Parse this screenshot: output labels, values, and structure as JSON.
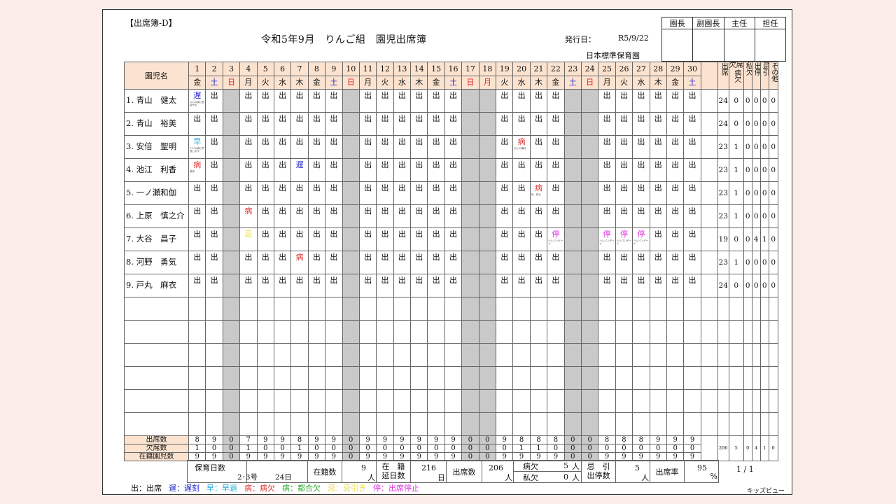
{
  "doc_id": "【出席簿-D】",
  "title": "令和5年9月　りんご組　園児出席簿",
  "issue_label": "発行日：",
  "issue_date": "R5/9/22",
  "school": "日本標準保育園",
  "approvals": [
    "園長",
    "副園長",
    "主任",
    "担任"
  ],
  "header": {
    "name_col": "園児名",
    "summary_cols": [
      {
        "top": "",
        "bottom": "出席"
      },
      {
        "top": "欠席",
        "bottom": "病欠"
      },
      {
        "top": "",
        "bottom": "私欠"
      },
      {
        "top": "",
        "bottom": "出停"
      },
      {
        "top": "",
        "bottom": "忌引"
      },
      {
        "top": "",
        "bottom": "その他"
      }
    ]
  },
  "days": [
    {
      "d": "1",
      "w": "金",
      "t": "w"
    },
    {
      "d": "2",
      "w": "土",
      "t": "sat"
    },
    {
      "d": "3",
      "w": "日",
      "t": "sun"
    },
    {
      "d": "4",
      "w": "月",
      "t": "w"
    },
    {
      "d": "5",
      "w": "火",
      "t": "w"
    },
    {
      "d": "6",
      "w": "水",
      "t": "w"
    },
    {
      "d": "7",
      "w": "木",
      "t": "w"
    },
    {
      "d": "8",
      "w": "金",
      "t": "w"
    },
    {
      "d": "9",
      "w": "土",
      "t": "sat"
    },
    {
      "d": "10",
      "w": "日",
      "t": "sun"
    },
    {
      "d": "11",
      "w": "月",
      "t": "w"
    },
    {
      "d": "12",
      "w": "火",
      "t": "w"
    },
    {
      "d": "13",
      "w": "水",
      "t": "w"
    },
    {
      "d": "14",
      "w": "木",
      "t": "w"
    },
    {
      "d": "15",
      "w": "金",
      "t": "w"
    },
    {
      "d": "16",
      "w": "土",
      "t": "sat"
    },
    {
      "d": "17",
      "w": "日",
      "t": "sun"
    },
    {
      "d": "18",
      "w": "月",
      "t": "sun"
    },
    {
      "d": "19",
      "w": "火",
      "t": "w"
    },
    {
      "d": "20",
      "w": "水",
      "t": "w"
    },
    {
      "d": "21",
      "w": "木",
      "t": "w"
    },
    {
      "d": "22",
      "w": "金",
      "t": "w"
    },
    {
      "d": "23",
      "w": "土",
      "t": "sat"
    },
    {
      "d": "24",
      "w": "日",
      "t": "sun"
    },
    {
      "d": "25",
      "w": "月",
      "t": "w"
    },
    {
      "d": "26",
      "w": "火",
      "t": "w"
    },
    {
      "d": "27",
      "w": "水",
      "t": "w"
    },
    {
      "d": "28",
      "w": "木",
      "t": "w"
    },
    {
      "d": "29",
      "w": "金",
      "t": "w"
    },
    {
      "d": "30",
      "w": "土",
      "t": "sat"
    }
  ],
  "gray_days": [
    3,
    10,
    17,
    18,
    23,
    24
  ],
  "mark_colors": {
    "出": "#111111",
    "遅": "#2222cc",
    "早": "#22aadd",
    "病": "#dd3333",
    "都": "#33aa33",
    "忌": "#e8d840",
    "停": "#dd33dd"
  },
  "children": [
    {
      "name": "1. 青山　健太",
      "marks": [
        "遅",
        "出",
        "",
        "出",
        "出",
        "出",
        "出",
        "出",
        "出",
        "",
        "出",
        "出",
        "出",
        "出",
        "出",
        "出",
        "",
        "",
        "出",
        "出",
        "出",
        "出",
        "",
        "",
        "出",
        "出",
        "出",
        "出",
        "出",
        "出"
      ],
      "notes": {
        "1": "10:30頃に登園予定"
      },
      "summary": [
        "24",
        "0",
        "0",
        "0",
        "0",
        "0"
      ]
    },
    {
      "name": "2. 青山　裕美",
      "marks": [
        "出",
        "出",
        "",
        "出",
        "出",
        "出",
        "出",
        "出",
        "出",
        "",
        "出",
        "出",
        "出",
        "出",
        "出",
        "出",
        "",
        "",
        "出",
        "出",
        "出",
        "出",
        "",
        "",
        "出",
        "出",
        "出",
        "出",
        "出",
        "出"
      ],
      "notes": {},
      "summary": [
        "24",
        "0",
        "0",
        "0",
        "0",
        "0"
      ]
    },
    {
      "name": "3. 安倍　聖明",
      "marks": [
        "早",
        "出",
        "",
        "出",
        "出",
        "出",
        "出",
        "出",
        "出",
        "",
        "出",
        "出",
        "出",
        "出",
        "出",
        "出",
        "",
        "",
        "出",
        "病",
        "出",
        "出",
        "",
        "",
        "出",
        "出",
        "出",
        "出",
        "出",
        "出"
      ],
      "notes": {
        "1": "11:30頃に早退します",
        "20": "のどの痛み"
      },
      "summary": [
        "23",
        "1",
        "0",
        "0",
        "0",
        "0"
      ]
    },
    {
      "name": "4. 池江　利香",
      "marks": [
        "病",
        "出",
        "",
        "出",
        "出",
        "出",
        "遅",
        "出",
        "出",
        "",
        "出",
        "出",
        "出",
        "出",
        "出",
        "出",
        "",
        "",
        "出",
        "出",
        "出",
        "出",
        "",
        "",
        "出",
        "出",
        "出",
        "出",
        "出",
        "出"
      ],
      "notes": {
        "1": "風邪"
      },
      "summary": [
        "23",
        "1",
        "0",
        "0",
        "0",
        "0"
      ]
    },
    {
      "name": "5. 一ノ瀬和伽",
      "marks": [
        "出",
        "出",
        "",
        "出",
        "出",
        "出",
        "出",
        "出",
        "出",
        "",
        "出",
        "出",
        "出",
        "出",
        "出",
        "出",
        "",
        "",
        "出",
        "出",
        "病",
        "出",
        "",
        "",
        "出",
        "出",
        "出",
        "出",
        "出",
        "出"
      ],
      "notes": {
        "21": "咳、鼻水"
      },
      "summary": [
        "23",
        "1",
        "0",
        "0",
        "0",
        "0"
      ]
    },
    {
      "name": "6. 上原　慎之介",
      "marks": [
        "出",
        "出",
        "",
        "病",
        "出",
        "出",
        "出",
        "出",
        "出",
        "",
        "出",
        "出",
        "出",
        "出",
        "出",
        "出",
        "",
        "",
        "出",
        "出",
        "出",
        "出",
        "",
        "",
        "出",
        "出",
        "出",
        "出",
        "出",
        "出"
      ],
      "notes": {},
      "summary": [
        "23",
        "1",
        "0",
        "0",
        "0",
        "0"
      ]
    },
    {
      "name": "7. 大谷　昌子",
      "marks": [
        "出",
        "出",
        "",
        "忌",
        "出",
        "出",
        "出",
        "出",
        "出",
        "",
        "出",
        "出",
        "出",
        "出",
        "出",
        "出",
        "",
        "",
        "出",
        "出",
        "出",
        "停",
        "",
        "",
        "停",
        "停",
        "停",
        "出",
        "出",
        "出"
      ],
      "notes": {
        "22": "ヘルパンギーナ",
        "25": "ヘルパンギーナ",
        "26": "ヘルパンギーナ",
        "27": "ヘルパンギーナ"
      },
      "summary": [
        "19",
        "0",
        "0",
        "4",
        "1",
        "0"
      ]
    },
    {
      "name": "8. 河野　勇気",
      "marks": [
        "出",
        "出",
        "",
        "出",
        "出",
        "出",
        "病",
        "出",
        "出",
        "",
        "出",
        "出",
        "出",
        "出",
        "出",
        "出",
        "",
        "",
        "出",
        "出",
        "出",
        "出",
        "",
        "",
        "出",
        "出",
        "出",
        "出",
        "出",
        "出"
      ],
      "notes": {},
      "summary": [
        "23",
        "1",
        "0",
        "0",
        "0",
        "0"
      ]
    },
    {
      "name": "9. 戸丸　麻衣",
      "marks": [
        "出",
        "出",
        "",
        "出",
        "出",
        "出",
        "出",
        "出",
        "出",
        "",
        "出",
        "出",
        "出",
        "出",
        "出",
        "出",
        "",
        "",
        "出",
        "出",
        "出",
        "出",
        "",
        "",
        "出",
        "出",
        "出",
        "出",
        "出",
        "出"
      ],
      "notes": {},
      "summary": [
        "24",
        "0",
        "0",
        "0",
        "0",
        "0"
      ]
    }
  ],
  "empty_rows": 6,
  "totals": {
    "labels": [
      "出席数",
      "欠席数",
      "在籍園児数"
    ],
    "attend": [
      "8",
      "9",
      "0",
      "7",
      "9",
      "9",
      "8",
      "9",
      "9",
      "0",
      "9",
      "9",
      "9",
      "9",
      "9",
      "9",
      "0",
      "0",
      "9",
      "8",
      "8",
      "8",
      "0",
      "0",
      "8",
      "8",
      "8",
      "9",
      "9",
      "9"
    ],
    "absent": [
      "1",
      "0",
      "0",
      "1",
      "0",
      "0",
      "1",
      "0",
      "0",
      "0",
      "0",
      "0",
      "0",
      "0",
      "0",
      "0",
      "0",
      "0",
      "0",
      "1",
      "1",
      "0",
      "0",
      "0",
      "0",
      "0",
      "0",
      "0",
      "0",
      "0"
    ],
    "enrolled": [
      "9",
      "9",
      "0",
      "9",
      "9",
      "9",
      "9",
      "9",
      "9",
      "0",
      "9",
      "9",
      "9",
      "9",
      "9",
      "9",
      "0",
      "0",
      "9",
      "9",
      "9",
      "9",
      "0",
      "0",
      "9",
      "9",
      "9",
      "9",
      "9",
      "9"
    ],
    "summary": [
      "206",
      "5",
      "0",
      "4",
      "1",
      "0"
    ]
  },
  "footer": {
    "hoiku_label": "保育日数",
    "hoiku_sub": "2･3号",
    "hoiku_val": "24日",
    "zaiseki_label": "在籍数",
    "zaiseki_val": "9",
    "zaiseki_unit": "人",
    "nobe_label1": "在　籍",
    "nobe_label2": "延日数",
    "nobe_val": "216",
    "nobe_unit": "日",
    "shusseki_label": "出席数",
    "shusseki_val": "206",
    "shusseki_unit": "人",
    "byoketsu_label": "病欠",
    "byoketsu_val": "5",
    "shiketsu_label": "私欠",
    "shiketsu_val": "0",
    "person_unit": "人",
    "kibiki_label1": "忌　引",
    "kibiki_label2": "出停数",
    "kibiki_val": "5",
    "rate_label": "出席率",
    "rate_val": "95",
    "rate_unit": "%"
  },
  "page_no": "1 / 1",
  "brand": "キッズビュー",
  "legend": [
    {
      "text": "出：出席",
      "color": "#111111"
    },
    {
      "text": "遅：遅刻",
      "color": "#2222cc"
    },
    {
      "text": "早：早退",
      "color": "#22aadd"
    },
    {
      "text": "病：病欠",
      "color": "#dd3333"
    },
    {
      "text": "病：都合欠",
      "color": "#33aa33"
    },
    {
      "text": "忌：忌引き",
      "color": "#e8d840"
    },
    {
      "text": "停：出席停止",
      "color": "#dd33dd"
    }
  ]
}
